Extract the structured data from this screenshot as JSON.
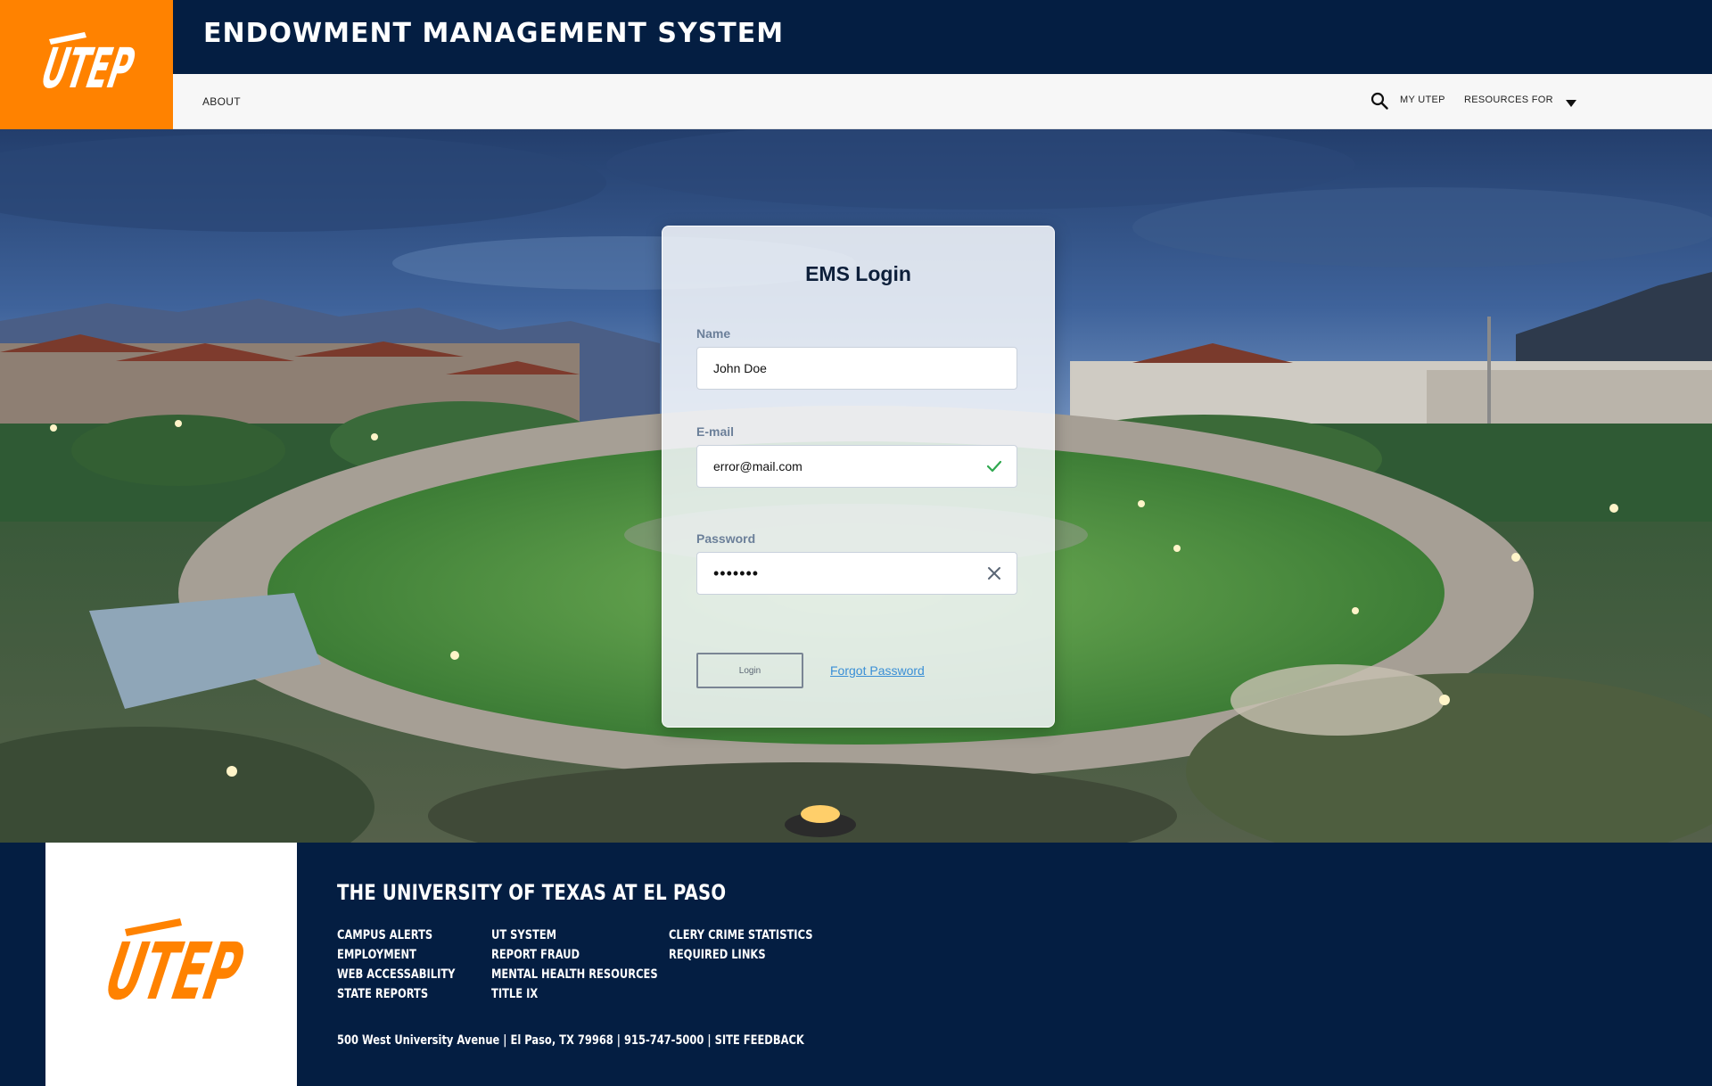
{
  "header": {
    "logo_text": "UTEP",
    "title": "ENDOWMENT MANAGEMENT SYSTEM"
  },
  "nav": {
    "about": "ABOUT",
    "my_utep": "MY UTEP",
    "resources_for": "RESOURCES FOR"
  },
  "login": {
    "title": "EMS Login",
    "name_label": "Name",
    "name_value": "John Doe",
    "email_label": "E-mail",
    "email_value": "error@mail.com",
    "password_label": "Password",
    "password_value": "•••••••",
    "login_button": "Login",
    "forgot_password": "Forgot Password"
  },
  "footer": {
    "university": "THE UNIVERSITY OF TEXAS AT EL PASO",
    "col1": [
      "CAMPUS ALERTS",
      "EMPLOYMENT",
      "WEB ACCESSABILITY",
      "STATE REPORTS"
    ],
    "col2": [
      "UT SYSTEM",
      "REPORT FRAUD",
      "MENTAL HEALTH RESOURCES",
      "TITLE IX"
    ],
    "col3": [
      "CLERY CRIME STATISTICS",
      "REQUIRED LINKS"
    ],
    "address": "500 West University Avenue | El Paso, TX 79968 | 915-747-5000 | SITE FEEDBACK"
  },
  "colors": {
    "navy": "#041e42",
    "orange": "#ff8200",
    "valid_green": "#2fa84f",
    "link_blue": "#3a8fd6"
  },
  "icons": {
    "search": "search-icon",
    "caret": "caret-down-icon",
    "valid": "check-icon",
    "invalid": "close-icon"
  }
}
